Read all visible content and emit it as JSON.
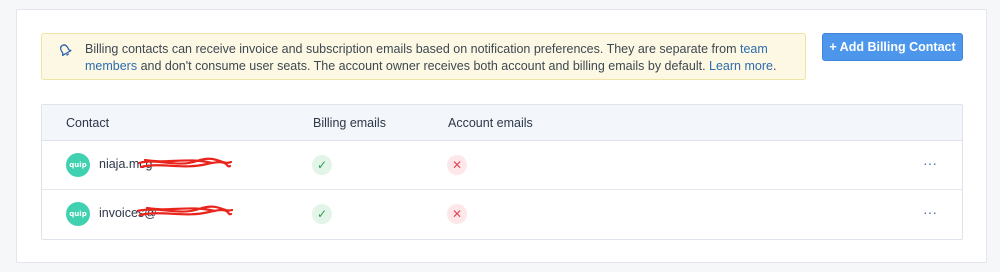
{
  "notice": {
    "text_before": "Billing contacts can receive invoice and subscription emails based on notification preferences. They are separate from ",
    "team_link": "team members",
    "text_middle": " and don't consume user seats. The account owner receives both account and billing emails by default. ",
    "learn_link": "Learn more",
    "text_after": "."
  },
  "add_button": "+ Add Billing Contact",
  "table": {
    "headers": [
      "Contact",
      "Billing emails",
      "Account emails"
    ],
    "rows": [
      {
        "avatar_text": "quip",
        "email": "niaja.mcg",
        "billing": "✓",
        "account": "✕",
        "more": "···"
      },
      {
        "avatar_text": "quip",
        "email": "invoices@",
        "billing": "✓",
        "account": "✕",
        "more": "···"
      }
    ]
  },
  "colors": {
    "accent": "#4c97ec",
    "avatar": "#3fd1b0",
    "check": "#2f9a4c",
    "cross": "#e04a5a",
    "notice_bg": "#fdf8e3",
    "redaction": "#e8241c"
  },
  "icons": [
    "bell-icon",
    "check-icon",
    "cross-icon",
    "more-options-icon"
  ]
}
